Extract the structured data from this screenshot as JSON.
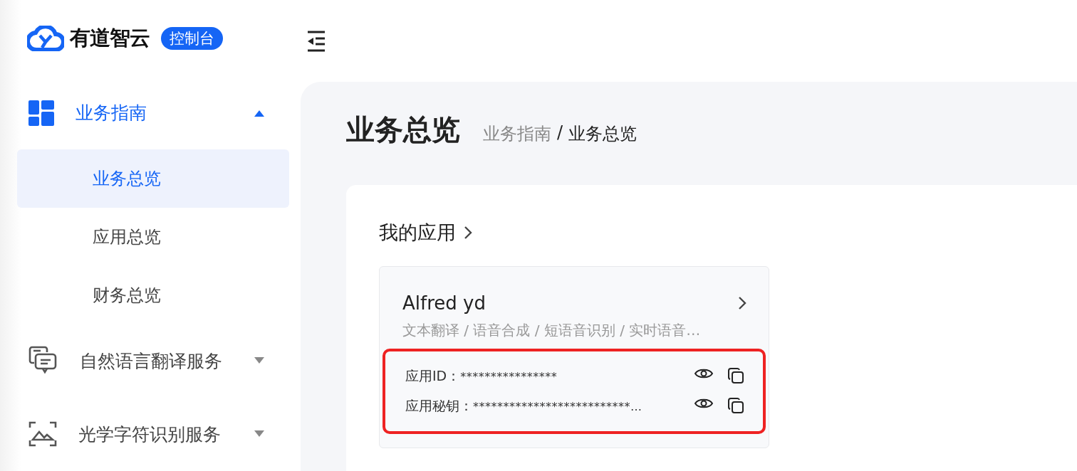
{
  "logo": {
    "name": "有道智云",
    "badge": "控制台"
  },
  "sidebar": {
    "groups": [
      {
        "label": "业务指南",
        "expanded": true,
        "children": [
          {
            "label": "业务总览",
            "selected": true
          },
          {
            "label": "应用总览",
            "selected": false
          },
          {
            "label": "财务总览",
            "selected": false
          }
        ]
      },
      {
        "label": "自然语言翻译服务",
        "expanded": false
      },
      {
        "label": "光学字符识别服务",
        "expanded": false
      }
    ]
  },
  "page": {
    "title": "业务总览",
    "breadcrumb": [
      "业务指南",
      "/",
      "业务总览"
    ]
  },
  "section": {
    "title": "我的应用"
  },
  "app_card": {
    "name": "Alfred yd",
    "services": "文本翻译 / 语音合成 / 短语音识别 / 实时语音…",
    "highlighted": true,
    "credentials": [
      {
        "label": "应用ID：",
        "value": "****************"
      },
      {
        "label": "应用秘钥：",
        "value": "**************************…"
      }
    ]
  }
}
